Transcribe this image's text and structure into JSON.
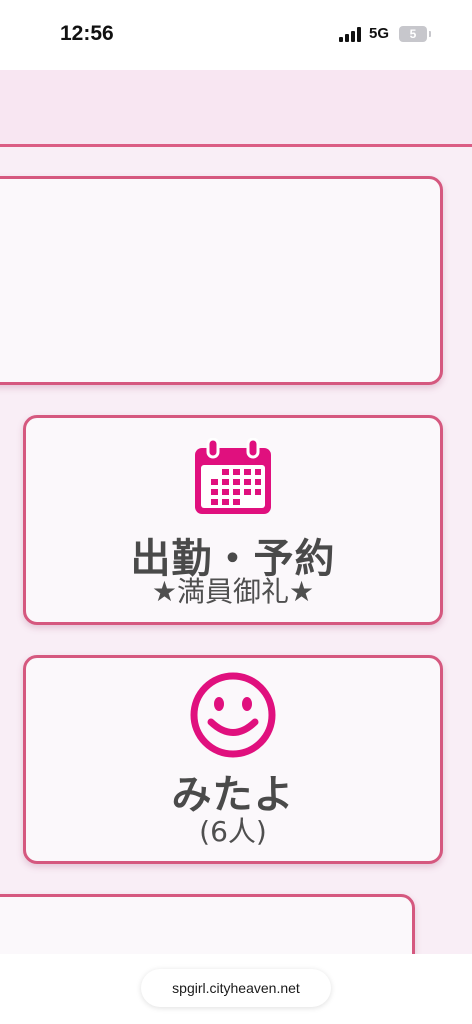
{
  "status_bar": {
    "time": "12:56",
    "network": "5G",
    "battery": "5",
    "icons": [
      "signal-icon",
      "battery-icon"
    ]
  },
  "cards": {
    "schedule": {
      "icon": "calendar-icon",
      "title": "出勤・予約",
      "subtitle": "★満員御礼★"
    },
    "mitayo": {
      "icon": "smiley-icon",
      "title": "みたよ",
      "subtitle": "(6人)"
    }
  },
  "url_bar": {
    "url": "spgirl.cityheaven.net"
  },
  "colors": {
    "accent": "#e0107e",
    "card_border": "#d5587f",
    "page_background": "#f9eef6",
    "text": "#4a4a4a"
  }
}
